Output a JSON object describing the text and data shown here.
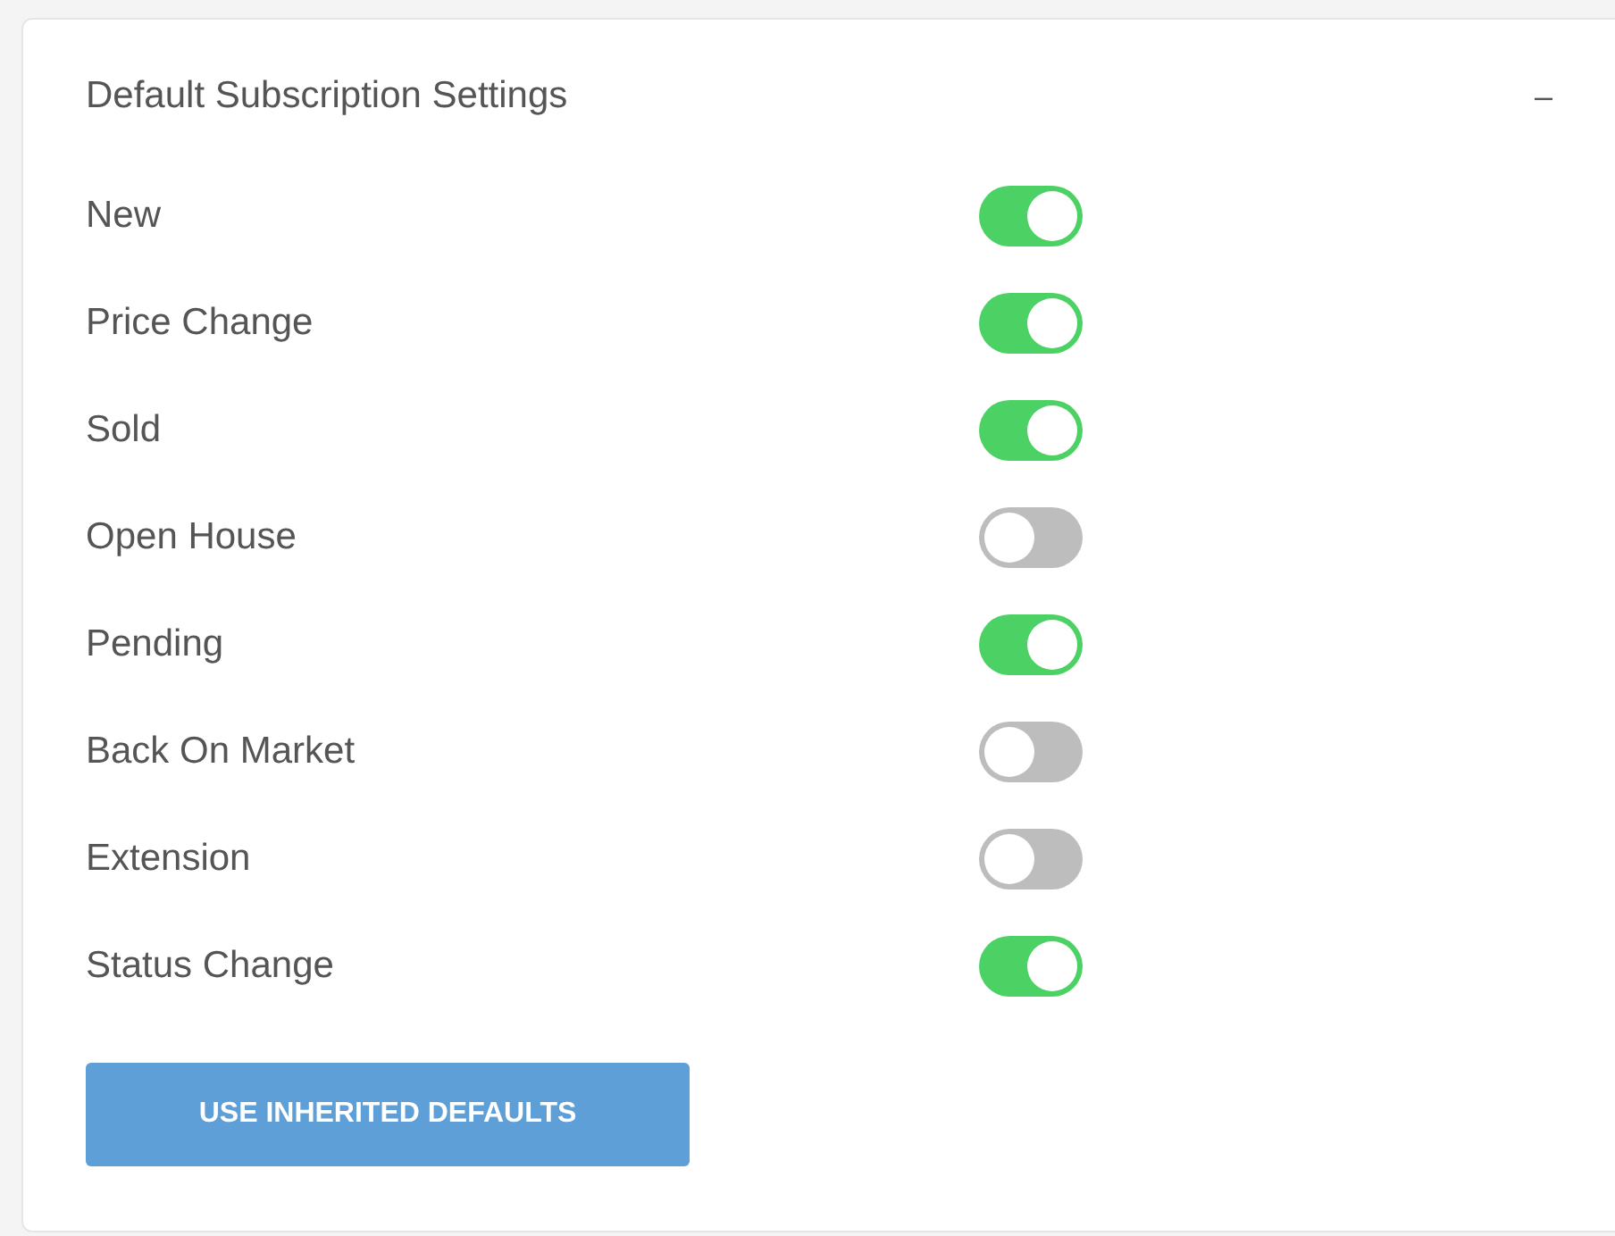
{
  "panel": {
    "title": "Default Subscription Settings",
    "collapse_symbol": "–"
  },
  "settings": [
    {
      "label": "New",
      "on": true
    },
    {
      "label": "Price Change",
      "on": true
    },
    {
      "label": "Sold",
      "on": true
    },
    {
      "label": "Open House",
      "on": false
    },
    {
      "label": "Pending",
      "on": true
    },
    {
      "label": "Back On Market",
      "on": false
    },
    {
      "label": "Extension",
      "on": false
    },
    {
      "label": "Status Change",
      "on": true
    }
  ],
  "button": "USE INHERITED DEFAULTS"
}
